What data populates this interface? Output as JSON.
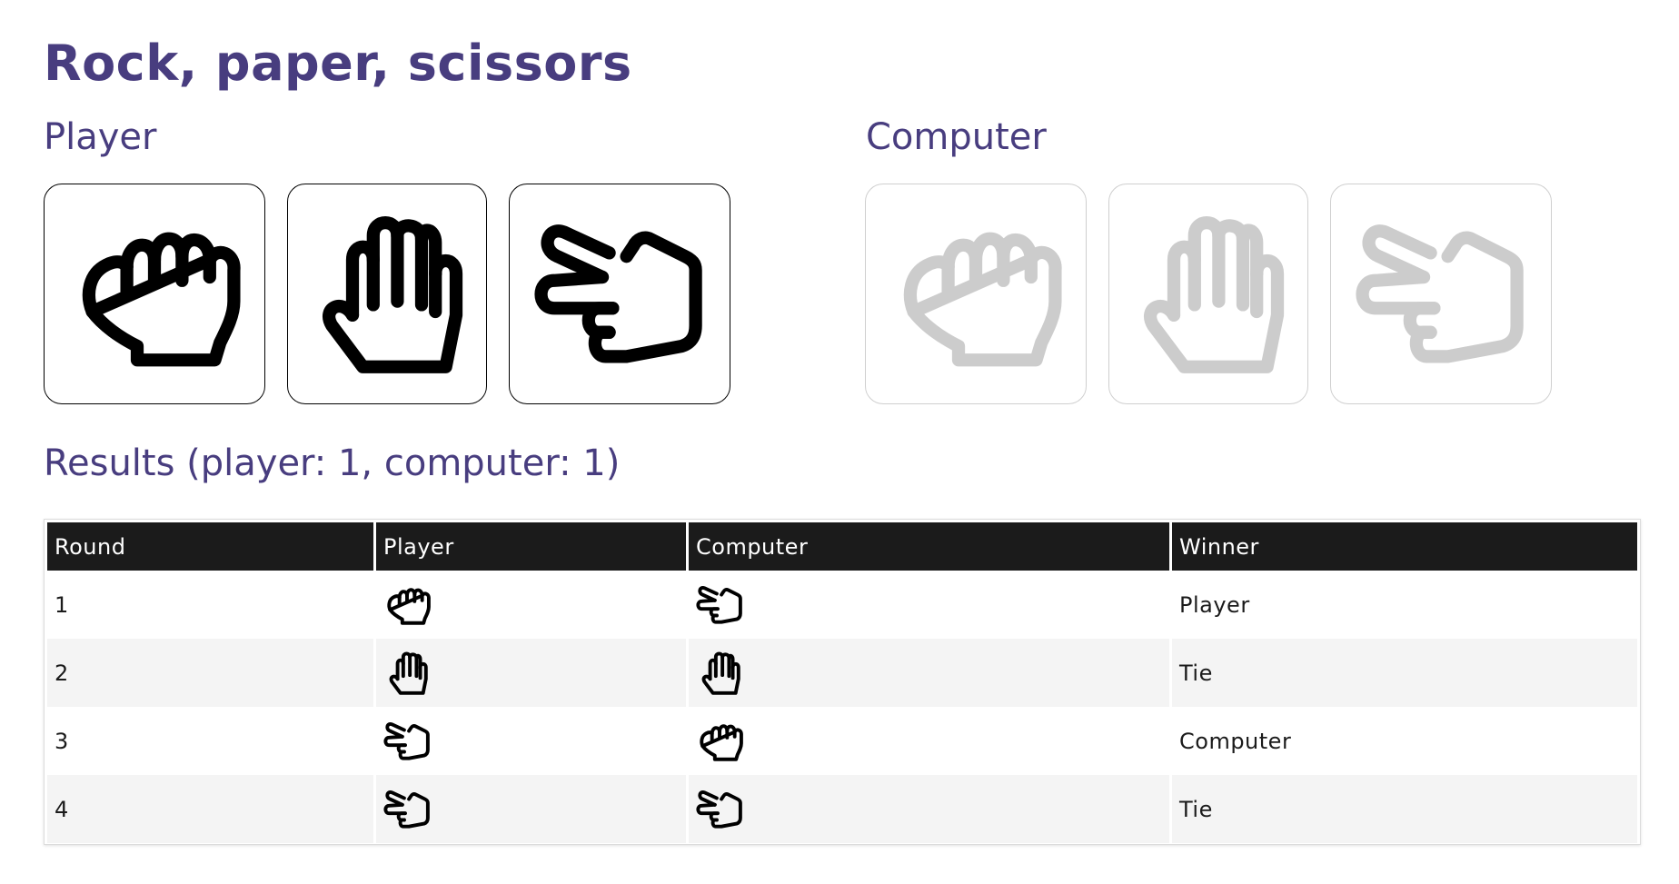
{
  "title": "Rock, paper, scissors",
  "player": {
    "heading": "Player",
    "choices": [
      {
        "name": "rock",
        "icon": "hand-rock-icon"
      },
      {
        "name": "paper",
        "icon": "hand-paper-icon"
      },
      {
        "name": "scissors",
        "icon": "hand-scissors-icon"
      }
    ]
  },
  "computer": {
    "heading": "Computer",
    "choices": [
      {
        "name": "rock",
        "icon": "hand-rock-icon",
        "disabled": true
      },
      {
        "name": "paper",
        "icon": "hand-paper-icon",
        "disabled": true
      },
      {
        "name": "scissors",
        "icon": "hand-scissors-icon",
        "disabled": true
      }
    ]
  },
  "results": {
    "heading": "Results (player: 1, computer: 1)",
    "columns": [
      "Round",
      "Player",
      "Computer",
      "Winner"
    ],
    "rows": [
      {
        "round": "1",
        "player": "rock",
        "computer": "scissors",
        "winner": "Player"
      },
      {
        "round": "2",
        "player": "paper",
        "computer": "paper",
        "winner": "Tie"
      },
      {
        "round": "3",
        "player": "scissors",
        "computer": "rock",
        "winner": "Computer"
      },
      {
        "round": "4",
        "player": "scissors",
        "computer": "scissors",
        "winner": "Tie"
      }
    ]
  },
  "colors": {
    "heading": "#483d7f",
    "icon_active": "#000000",
    "icon_disabled": "#cccccc",
    "table_header_bg": "#1b1b1b",
    "table_stripe": "#f4f4f4"
  }
}
